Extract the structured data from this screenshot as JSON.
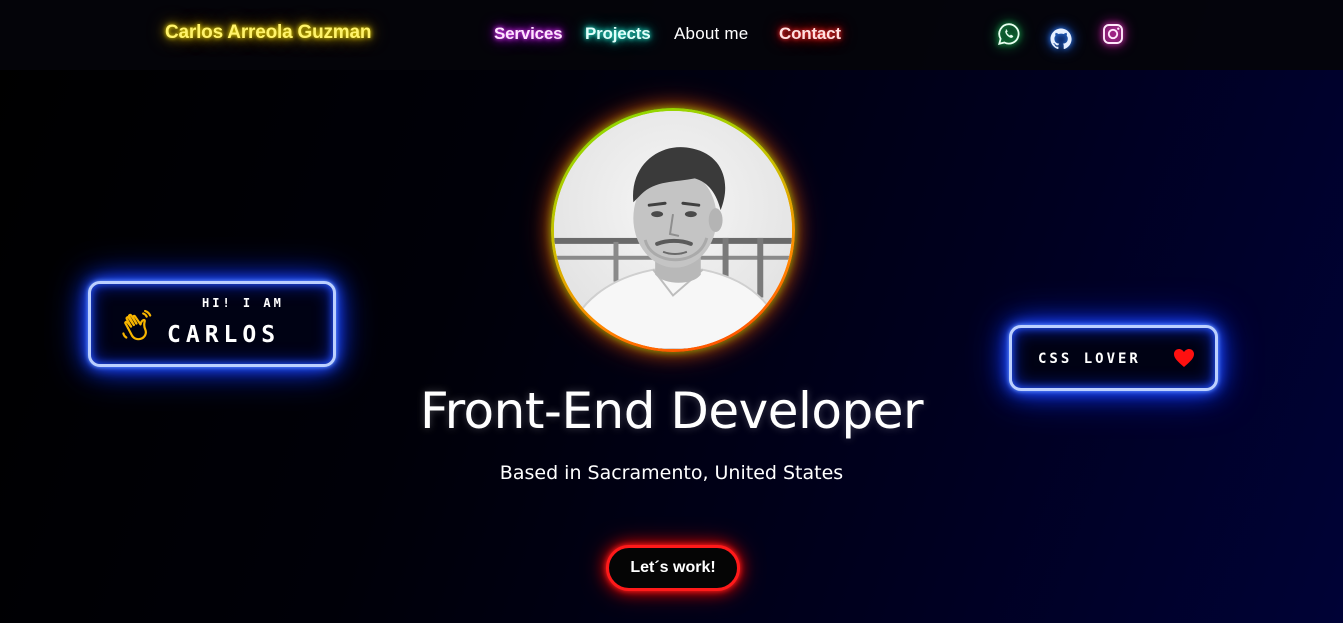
{
  "nav": {
    "brand": "Carlos Arreola Guzman",
    "links": [
      {
        "label": "Services",
        "glow_color": "#c200f0"
      },
      {
        "label": "Projects",
        "glow_color": "#00c2b0"
      },
      {
        "label": "About me",
        "glow_color": "#ffffff"
      },
      {
        "label": "Contact",
        "glow_color": "#e00000"
      }
    ],
    "social": [
      {
        "icon": "whatsapp-icon",
        "color": "#25d366"
      },
      {
        "icon": "github-icon",
        "color": "#3a8bff"
      },
      {
        "icon": "instagram-icon",
        "color": "#ff4fd8"
      }
    ]
  },
  "hero": {
    "badge_left": {
      "small_text": "Hi! I am",
      "big_text": "Carlos",
      "icon": "waving-hand-icon"
    },
    "badge_right": {
      "text": "CSS lover",
      "icon": "heart-icon"
    },
    "avatar": {
      "icon": "profile-photo"
    },
    "title": "Front-End Developer",
    "subtitle": "Based in Sacramento, United States",
    "cta_label": "Let´s work!"
  },
  "colors": {
    "background": "#000000",
    "brand_glow": "#f6e400",
    "badge_glow": "#1038ff",
    "cta_border": "#ff1a1a",
    "avatar_ring_start": "#7fe000",
    "avatar_ring_end": "#ff3a00"
  }
}
